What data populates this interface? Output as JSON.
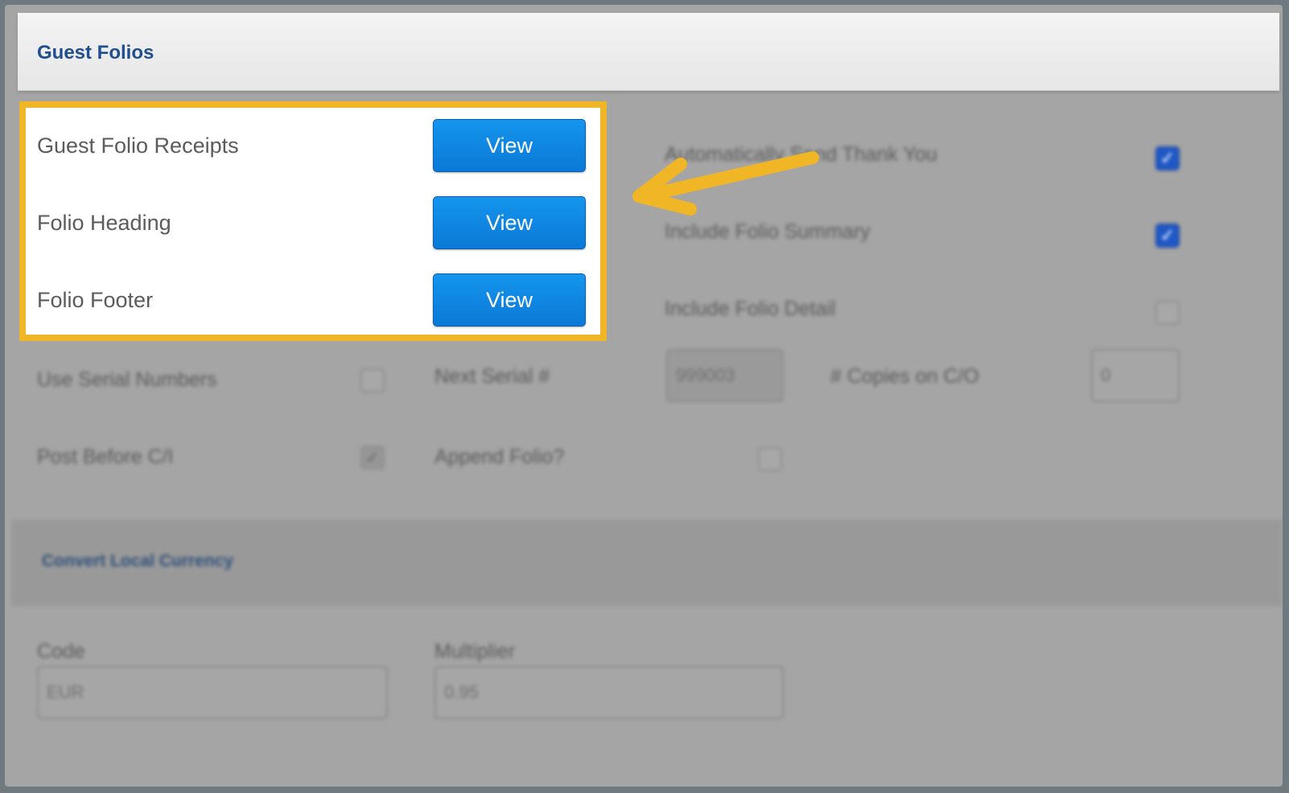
{
  "header": {
    "title": "Guest Folios"
  },
  "highlighted": {
    "rows": [
      {
        "label": "Guest Folio Receipts",
        "button": "View"
      },
      {
        "label": "Folio Heading",
        "button": "View"
      },
      {
        "label": "Folio Footer",
        "button": "View"
      }
    ]
  },
  "right_options": [
    {
      "label": "Automatically Send Thank You",
      "checked": true
    },
    {
      "label": "Include Folio Summary",
      "checked": true
    },
    {
      "label": "Include Folio Detail",
      "checked": false
    }
  ],
  "serial": {
    "use_serial_label": "Use Serial Numbers",
    "next_serial_label": "Next Serial #",
    "next_serial_value": "999003",
    "copies_label": "# Copies on C/O",
    "copies_value": "0"
  },
  "post": {
    "post_before_label": "Post Before C/I",
    "append_folio_label": "Append Folio?"
  },
  "currency": {
    "section_title": "Convert Local Currency",
    "code_label": "Code",
    "code_value": "EUR",
    "multiplier_label": "Multiplier",
    "multiplier_value": "0.95"
  },
  "colors": {
    "highlight": "#f0b626",
    "button": "#0a79d6",
    "title": "#1f4f8f"
  }
}
